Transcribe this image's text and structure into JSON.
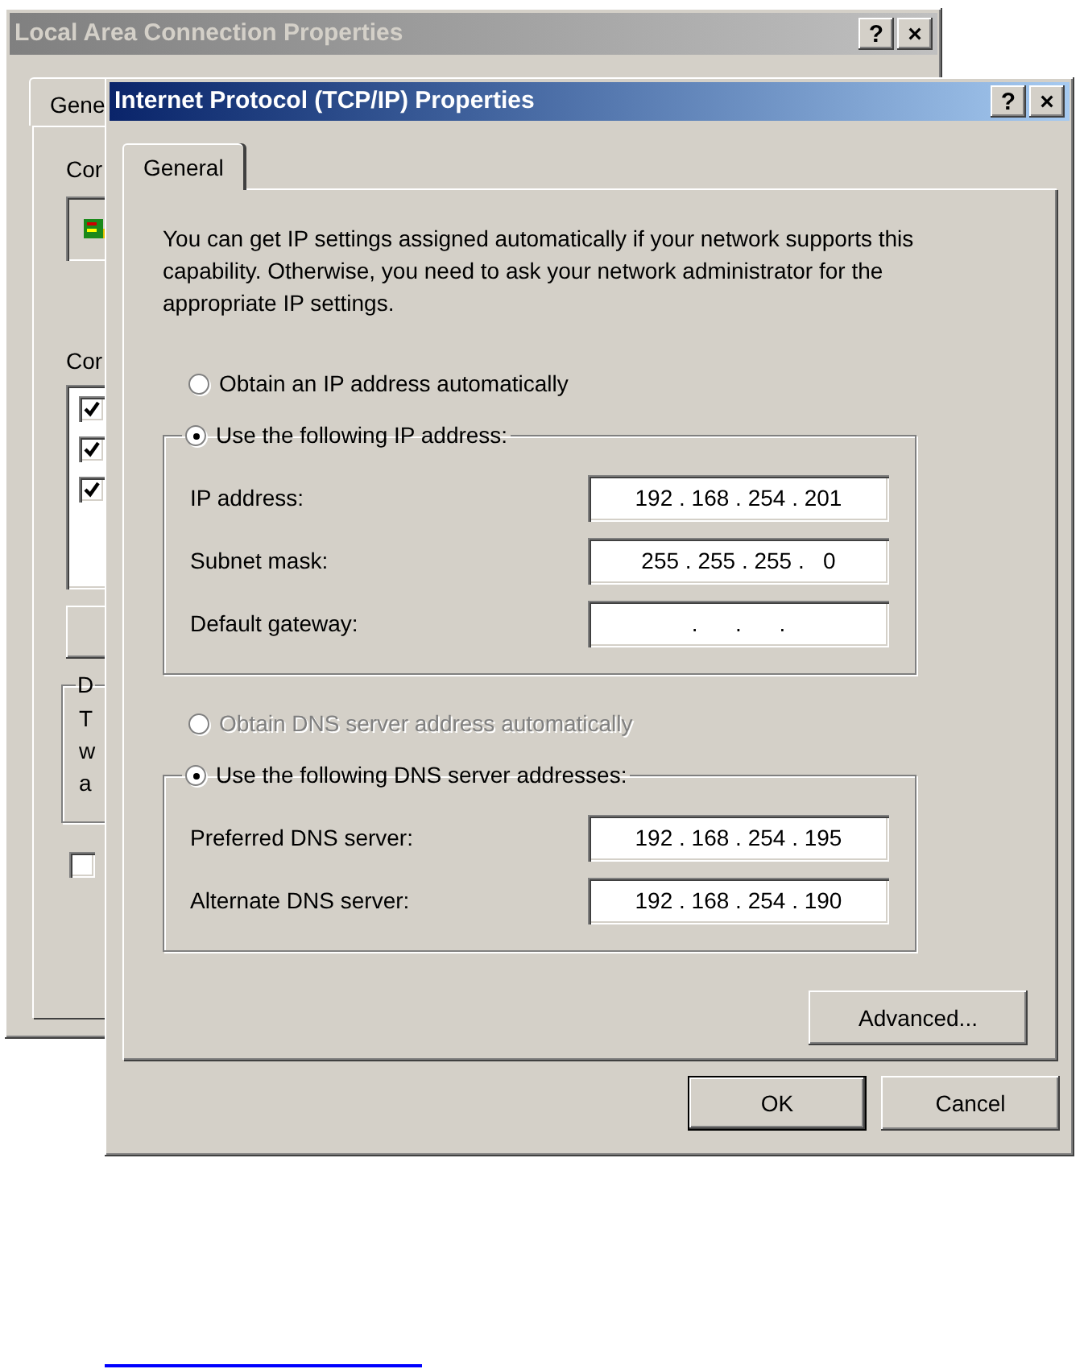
{
  "background_window": {
    "title": "Local Area Connection Properties",
    "title_buttons": [
      "?",
      "×"
    ],
    "tab": {
      "label": "Gene",
      "selected": true
    },
    "labels": [
      "Cor",
      "Cor"
    ],
    "component_checkboxes": [
      {
        "checked": true
      },
      {
        "checked": true
      },
      {
        "checked": true
      }
    ],
    "group_label": "D",
    "group_lines": [
      "T",
      "w",
      "a"
    ],
    "bottom_checkbox": {
      "checked": false
    }
  },
  "window": {
    "title": "Internet Protocol (TCP/IP) Properties",
    "title_buttons": [
      "?",
      "×"
    ],
    "tabs": [
      {
        "label": "General",
        "selected": true
      }
    ],
    "intro": "You can get IP settings assigned automatically if your network supports this capability. Otherwise, you need to ask your network administrator for the appropriate IP settings.",
    "sections": [
      {
        "auto_option": {
          "label": "Obtain an IP address automatically",
          "selected": false,
          "disabled": false
        },
        "manual_option": {
          "label": "Use the following IP address:",
          "selected": true,
          "disabled": false
        },
        "fields": [
          {
            "label": "IP address:",
            "value": "192 . 168 . 254 . 201"
          },
          {
            "label": "Subnet mask:",
            "value": "255 . 255 . 255 .   0"
          },
          {
            "label": "Default gateway:",
            "value": "    .      .      .    "
          }
        ]
      },
      {
        "auto_option": {
          "label": "Obtain DNS server address automatically",
          "selected": false,
          "disabled": true
        },
        "manual_option": {
          "label": "Use the following DNS server addresses:",
          "selected": true,
          "disabled": false
        },
        "fields": [
          {
            "label": "Preferred DNS server:",
            "value": "192 . 168 . 254 . 195"
          },
          {
            "label": "Alternate DNS server:",
            "value": "192 . 168 . 254 . 190"
          }
        ]
      }
    ],
    "advanced_button": "Advanced...",
    "buttons": [
      {
        "label": "OK",
        "default": true
      },
      {
        "label": "Cancel",
        "default": false
      }
    ]
  }
}
